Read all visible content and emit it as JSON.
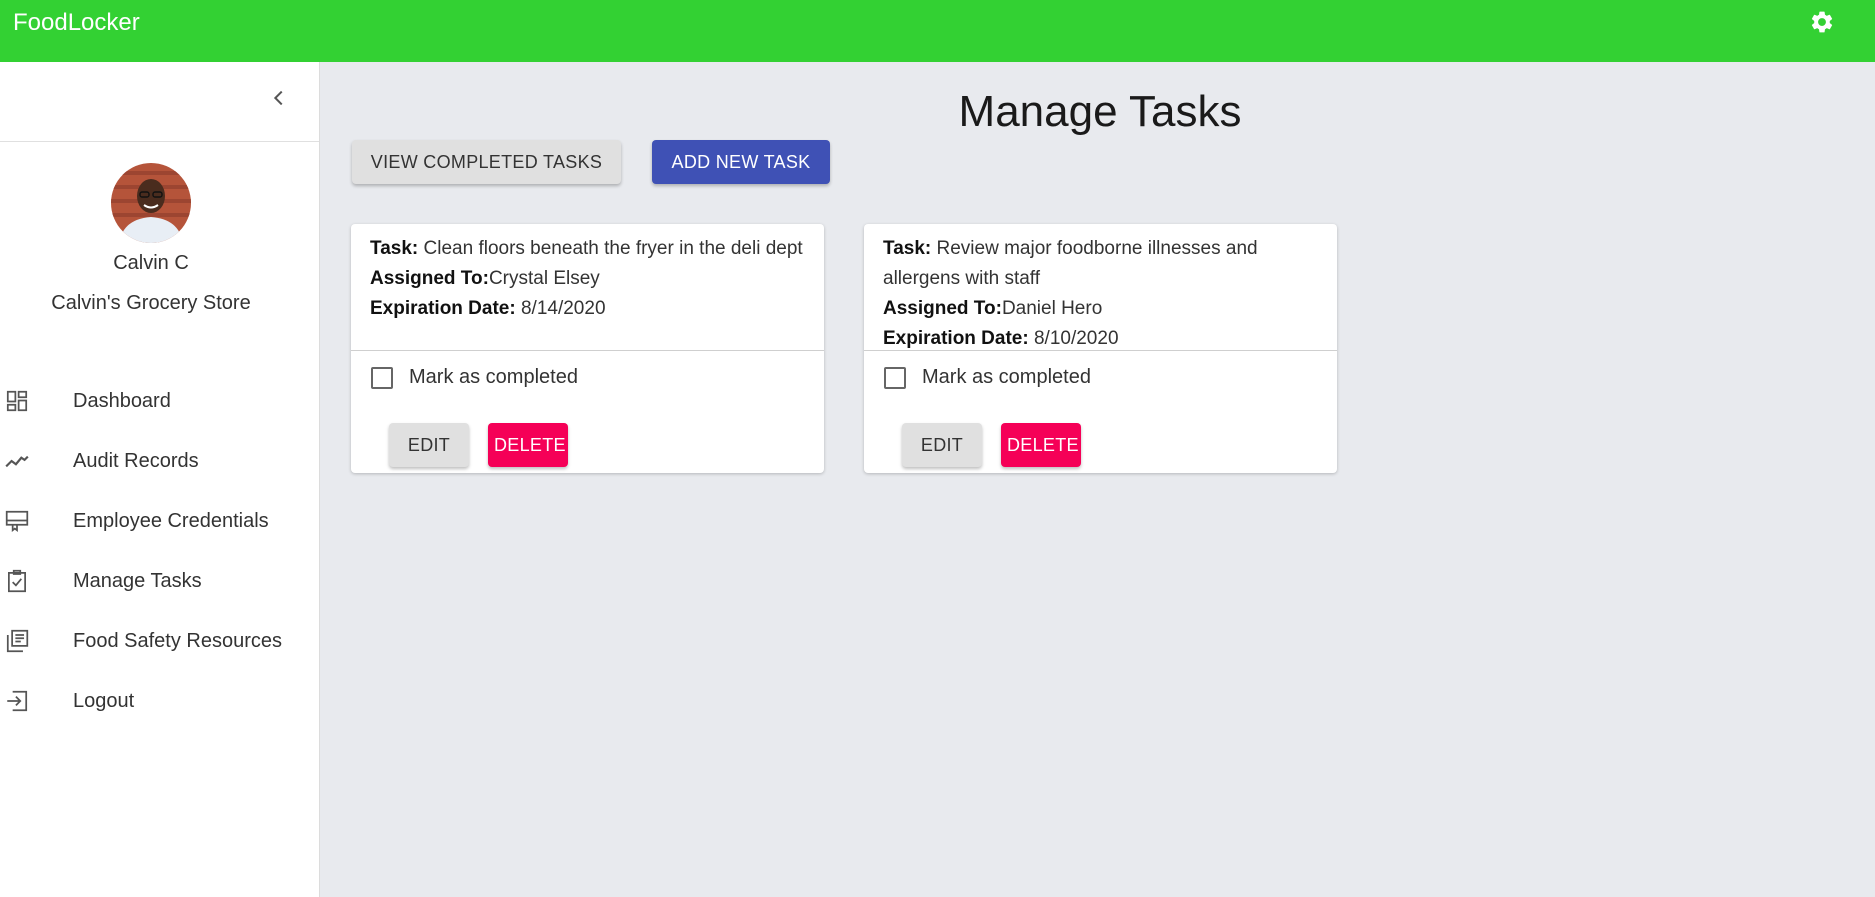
{
  "app": {
    "title": "FoodLocker"
  },
  "user": {
    "name": "Calvin C",
    "store": "Calvin's Grocery Store"
  },
  "nav": [
    {
      "label": "Dashboard",
      "icon": "dashboard-icon"
    },
    {
      "label": "Audit Records",
      "icon": "trending-icon"
    },
    {
      "label": "Employee Credentials",
      "icon": "card-membership-icon"
    },
    {
      "label": "Manage Tasks",
      "icon": "assignment-check-icon"
    },
    {
      "label": "Food Safety Resources",
      "icon": "library-books-icon"
    },
    {
      "label": "Logout",
      "icon": "exit-icon"
    }
  ],
  "page": {
    "title": "Manage Tasks",
    "view_completed_label": "View Completed Tasks",
    "add_new_label": "Add New Task"
  },
  "tasks": [
    {
      "task_label": "Task:",
      "task": "Clean floors beneath the fryer in the deli dept",
      "assigned_label": "Assigned To:",
      "assigned": "Crystal Elsey",
      "expiration_label": "Expiration Date:",
      "expiration": "8/14/2020",
      "mark_label": "Mark as completed",
      "edit_label": "Edit",
      "delete_label": "Delete"
    },
    {
      "task_label": "Task:",
      "task": "Review major foodborne illnesses and allergens with staff",
      "assigned_label": "Assigned To:",
      "assigned": "Daniel Hero",
      "expiration_label": "Expiration Date:",
      "expiration": "8/10/2020",
      "mark_label": "Mark as completed",
      "edit_label": "Edit",
      "delete_label": "Delete"
    }
  ],
  "colors": {
    "appbar": "#33d133",
    "primary_button": "#3f51b5",
    "delete_button": "#f50057",
    "background": "#e8eaee"
  }
}
